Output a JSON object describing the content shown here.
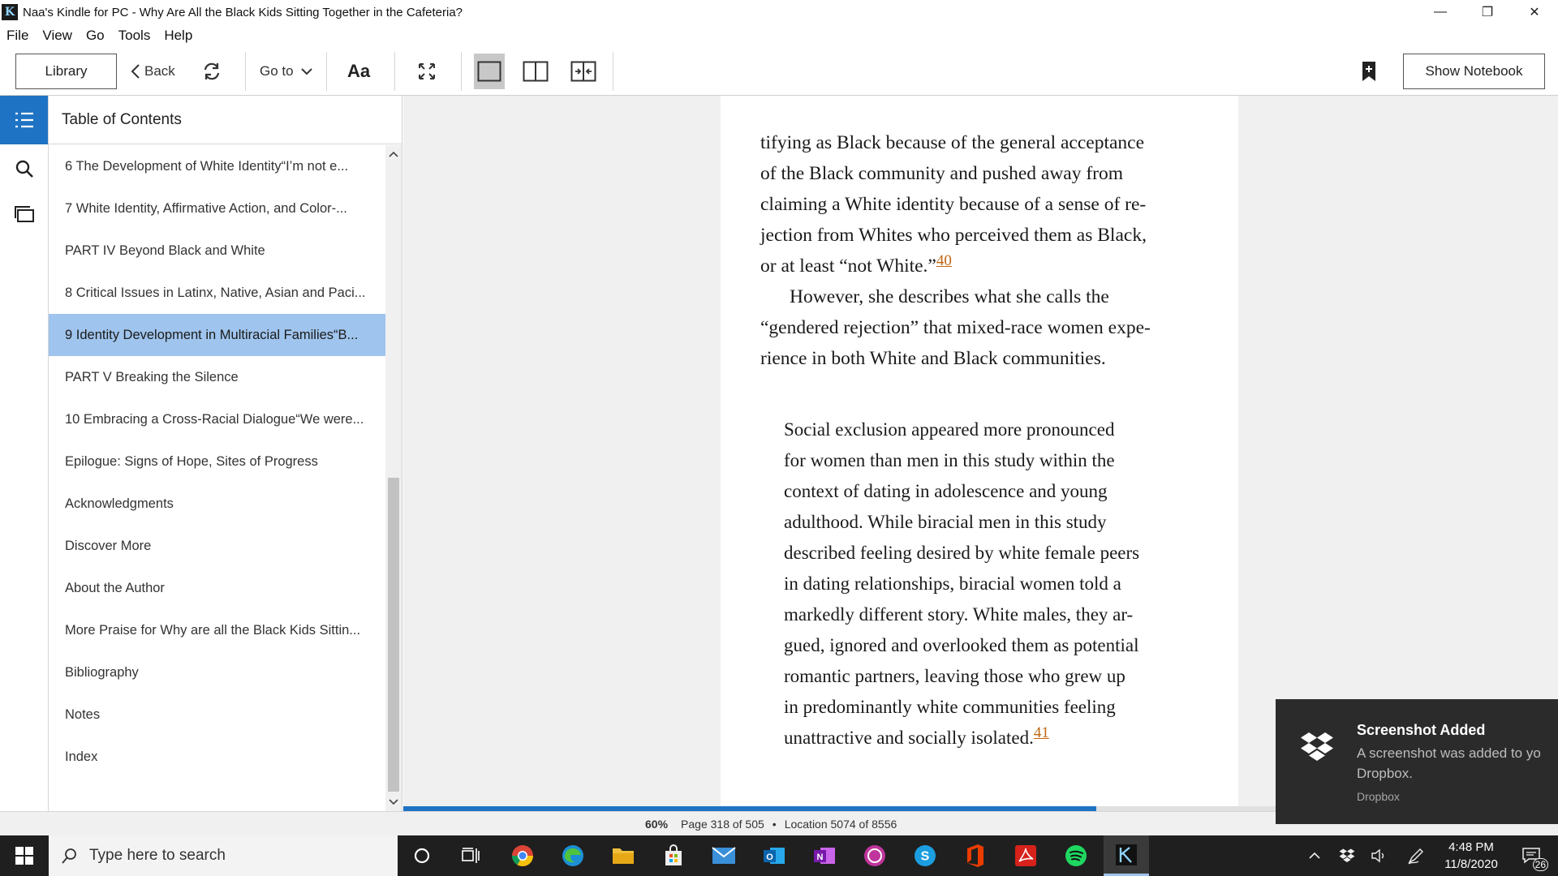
{
  "window": {
    "title": "Naa's Kindle for PC - Why Are All the Black Kids Sitting Together in the Cafeteria?",
    "minimize": "—",
    "restore": "❐",
    "close": "✕"
  },
  "menu": [
    "File",
    "View",
    "Go",
    "Tools",
    "Help"
  ],
  "toolbar": {
    "library": "Library",
    "back": "Back",
    "goto": "Go to",
    "font": "Aa",
    "show_notebook": "Show Notebook"
  },
  "toc": {
    "header": "Table of Contents",
    "items": [
      "6 The Development of White Identity“I’m not e...",
      "7 White Identity, Affirmative Action, and Color-...",
      "PART IV Beyond Black and White",
      "8 Critical Issues in Latinx, Native, Asian and Paci...",
      "9 Identity Development in Multiracial Families“B...",
      "PART V Breaking the Silence",
      "10 Embracing a Cross-Racial Dialogue“We were...",
      "Epilogue: Signs of Hope, Sites of Progress",
      "Acknowledgments",
      "Discover More",
      "About the Author",
      "More Praise for Why are all the Black Kids Sittin...",
      "Bibliography",
      "Notes",
      "Index"
    ],
    "selected_index": 4
  },
  "page": {
    "p1_lines": [
      "tifying as Black because of the general acceptance",
      "of the Black community and pushed away from",
      "claiming a White identity because of a sense of re-",
      "jection from Whites who perceived them as Black,"
    ],
    "p1_last": "or at least “not White.”",
    "p1_note": "40",
    "p2_lines": [
      "However, she describes what she calls the",
      "“gendered rejection” that mixed-race women expe-",
      "rience in both White and Black communities."
    ],
    "quote_lines": [
      "Social exclusion appeared more pronounced",
      "for women than men in this study within the",
      "context of dating in adolescence and young",
      "adulthood. While biracial men in this study",
      "described feeling desired by white female peers",
      "in dating relationships, biracial women told a",
      "markedly different story. White males, they ar-",
      "gued, ignored and overlooked them as potential",
      "romantic partners, leaving those who grew up",
      "in predominantly white communities feeling"
    ],
    "quote_last": "unattractive and socially isolated.",
    "quote_note": "41"
  },
  "progress": 0.6,
  "status": {
    "percent": "60%",
    "page": "Page 318 of 505",
    "sep": "•",
    "location": "Location 5074 of 8556"
  },
  "taskbar": {
    "search_placeholder": "Type here to search",
    "time": "4:48 PM",
    "date": "11/8/2020",
    "notifications": "26",
    "apps": [
      "cortana-icon",
      "task-view-icon",
      "chrome-icon",
      "edge-icon",
      "file-explorer-icon",
      "store-icon",
      "mail-icon",
      "outlook-icon",
      "onenote-icon",
      "whatsapp-icon",
      "skype-icon",
      "office-icon",
      "acrobat-icon",
      "spotify-icon",
      "kindle-icon"
    ]
  },
  "toast": {
    "title": "Screenshot Added",
    "body_line1": "A screenshot was added to yo",
    "body_line2": "Dropbox.",
    "source": "Dropbox"
  },
  "colors": {
    "accent": "#1f73c4",
    "selected": "#9fc4ed",
    "note_link": "#c0660f"
  }
}
